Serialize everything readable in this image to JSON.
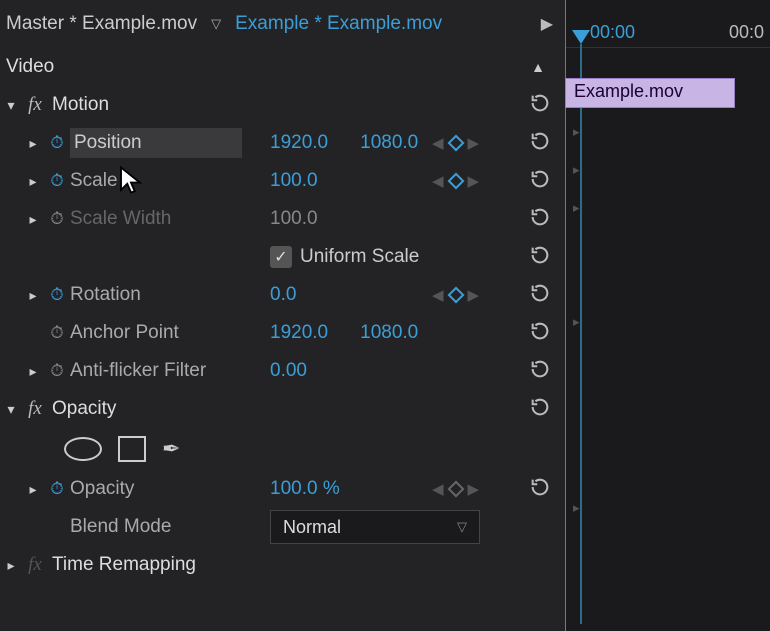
{
  "header": {
    "master": "Master * Example.mov",
    "clip": "Example * Example.mov"
  },
  "video_label": "Video",
  "timeline": {
    "t0": "00:00",
    "t1": "00:0",
    "clip_name": "Example.mov"
  },
  "effects": {
    "motion": {
      "label": "Motion",
      "props": {
        "position": {
          "label": "Position",
          "x": "1920.0",
          "y": "1080.0"
        },
        "scale": {
          "label": "Scale",
          "v": "100.0"
        },
        "scale_width": {
          "label": "Scale Width",
          "v": "100.0"
        },
        "uniform_scale": {
          "label": "Uniform Scale"
        },
        "rotation": {
          "label": "Rotation",
          "v": "0.0"
        },
        "anchor": {
          "label": "Anchor Point",
          "x": "1920.0",
          "y": "1080.0"
        },
        "antiflicker": {
          "label": "Anti-flicker Filter",
          "v": "0.00"
        }
      }
    },
    "opacity": {
      "label": "Opacity",
      "props": {
        "opacity": {
          "label": "Opacity",
          "v": "100.0 %"
        },
        "blend": {
          "label": "Blend Mode",
          "v": "Normal"
        }
      }
    },
    "time_remap": {
      "label": "Time Remapping"
    }
  }
}
